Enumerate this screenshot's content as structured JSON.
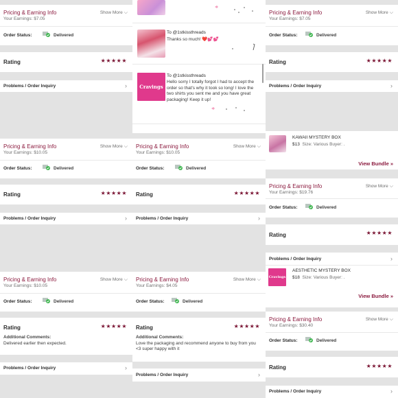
{
  "labels": {
    "pricing_title": "Pricing & Earning Info",
    "show_more": "Show More",
    "order_status": "Order Status:",
    "delivered": "Delivered",
    "rating": "Rating",
    "stars": "★★★★★",
    "problems": "Problems / Order Inquiry",
    "additional_comments": "Additional Comments:",
    "view_bundle": "View Bundle »"
  },
  "earnings": {
    "c1a": "Your Earnings: $7.05",
    "c3a": "Your Earnings: $7.05",
    "c1b": "Your Earnings: $10.05",
    "c2b": "Your Earnings: $10.05",
    "c3b": "Your Earnings: $19.76",
    "c1c": "Your Earnings: $10.05",
    "c2c": "Your Earnings: $4.05",
    "c3c": "Your Earnings: $30.40"
  },
  "comments": {
    "c1c": "Delivered earlier then expected.",
    "c2c": "Love the packaging and recommend anyone to buy from you <3 super happy with it"
  },
  "messages": [
    {
      "to": "To @1stkissthreads",
      "text": "Thanks so much! ❤️💕💕"
    },
    {
      "to": "To @1stkissthreads",
      "text": "Hello sorry I totally forgot I had to accept the order so that's why it took so long! I love the two shirts you sent me and you have great packaging! Keep it up!",
      "thumb_label": "Cravings"
    }
  ],
  "bundles": [
    {
      "name": "KAWAII MYSTERY BOX",
      "price": "$13",
      "meta": "Size: Various  Buyer: ."
    },
    {
      "name": "AESTHETIC MYSTERY BOX",
      "price": "$18",
      "meta": "Size: Various  Buyer: .",
      "thumb_label": "Cravings"
    }
  ],
  "colors": {
    "accent": "#8b1a3e",
    "star": "#7a1433",
    "check": "#3fb650",
    "box": "#b9c7c0",
    "pink": "#e0398c"
  },
  "icons": [
    "delivered-box-icon",
    "chevron-right-icon",
    "chevron-down-icon",
    "star-icon"
  ]
}
